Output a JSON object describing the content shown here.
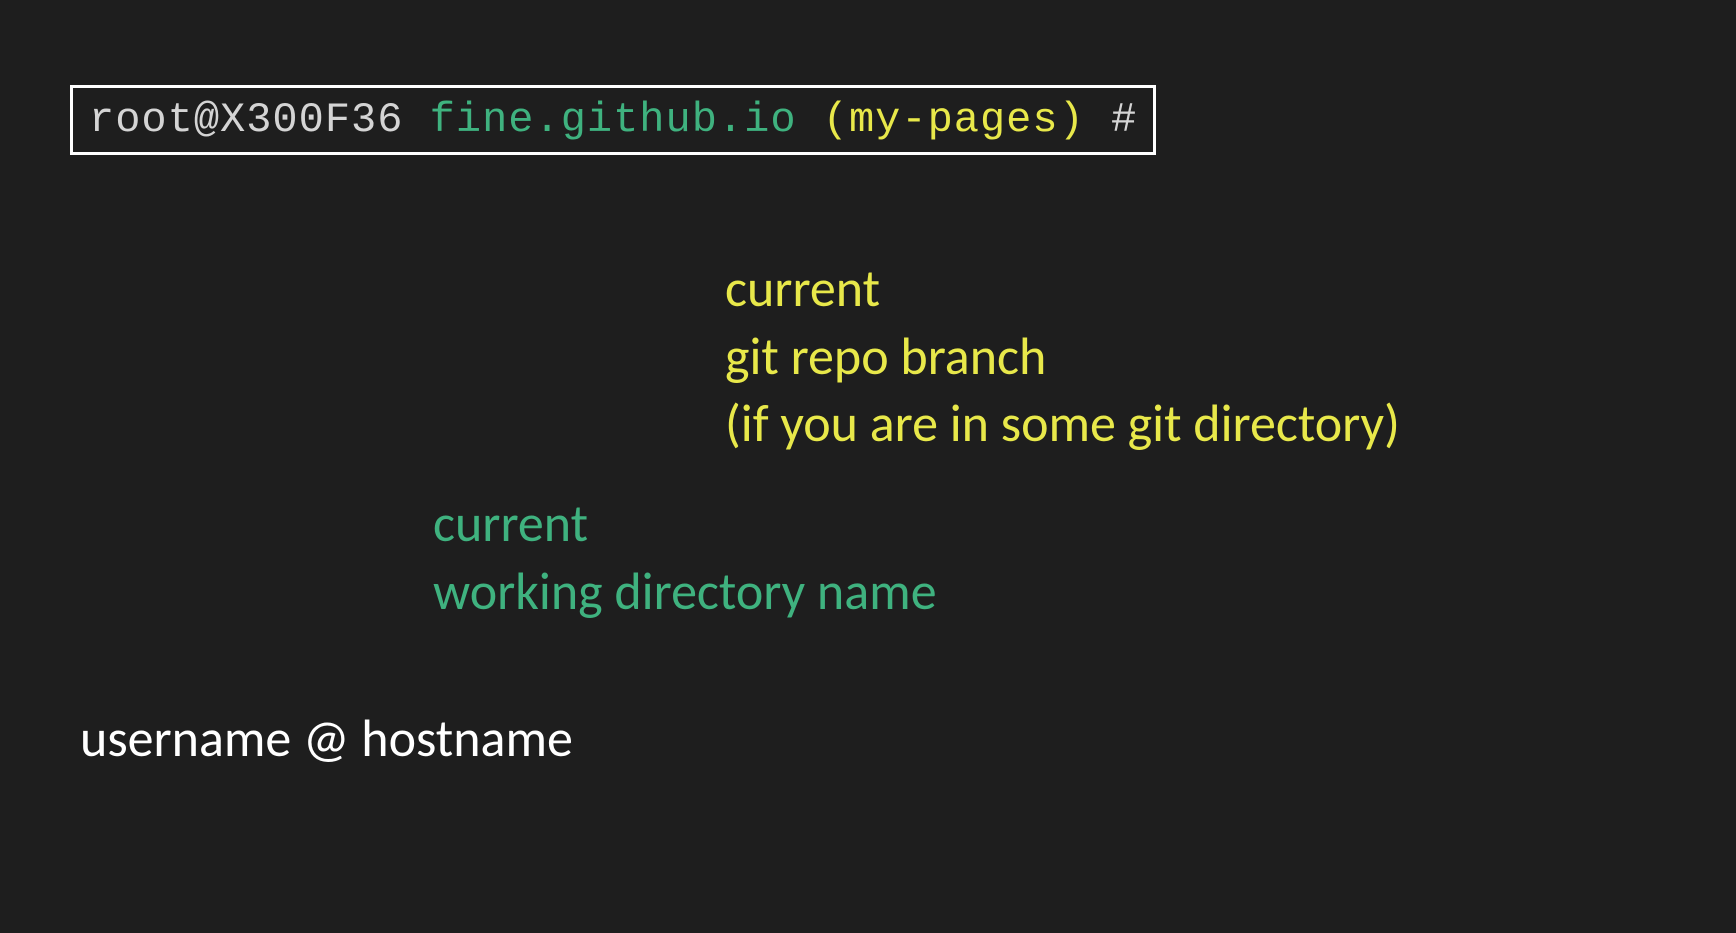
{
  "prompt": {
    "user_host": "root@X300F36",
    "repo": "fine.github.io",
    "branch": "(my-pages)",
    "suffix": "#"
  },
  "annotations": {
    "branch": {
      "line1": "current",
      "line2": "git repo branch",
      "line3": "(if you are in some git directory)"
    },
    "directory": {
      "line1": "current",
      "line2": "working directory name"
    },
    "userhost": {
      "line1": "username @ hostname"
    }
  }
}
